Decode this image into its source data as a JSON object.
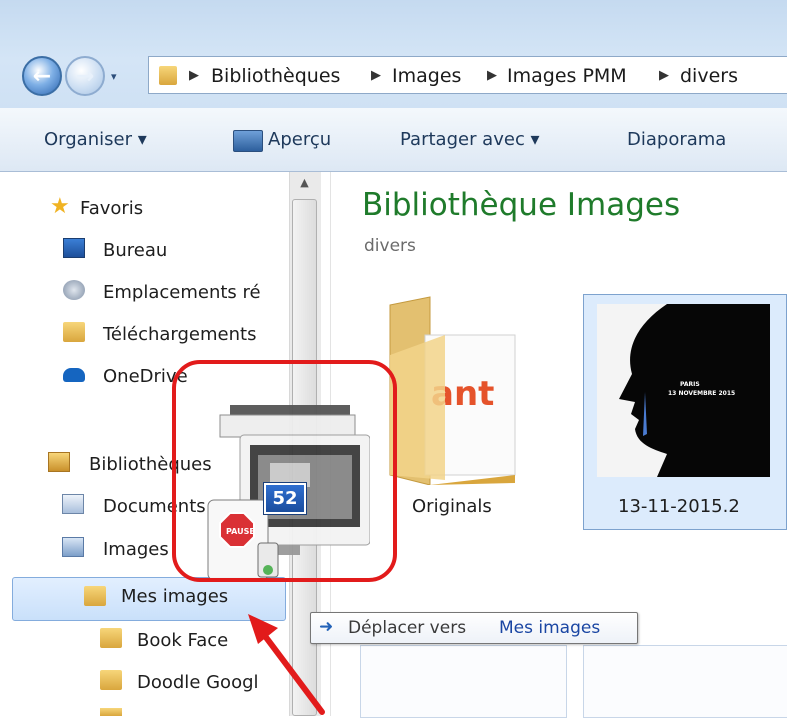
{
  "address_bar": {
    "history_arrow": "▾",
    "breadcrumb": [
      "Bibliothèques",
      "Images",
      "Images PMM",
      "divers"
    ]
  },
  "toolbar": {
    "organize_label": "Organiser ▾",
    "preview_label": "Aperçu",
    "share_label": "Partager avec ▾",
    "slideshow_label": "Diaporama"
  },
  "nav": {
    "favorites": "Favoris",
    "desktop": "Bureau",
    "recent_places": "Emplacements ré",
    "downloads": "Téléchargements",
    "onedrive": "OneDrive",
    "libraries": "Bibliothèques",
    "documents": "Documents",
    "images": "Images",
    "my_images": "Mes images",
    "book_face": "Book Face",
    "doodle": "Doodle Googl"
  },
  "content": {
    "title": "Bibliothèque Images",
    "subtitle": "divers",
    "items": [
      {
        "label": "Originals",
        "type": "folder"
      },
      {
        "label": "13-11-2015.2",
        "type": "image"
      }
    ],
    "thumb_text_1": "PARIS",
    "thumb_text_2": "13 NOVEMBRE 2015"
  },
  "drag": {
    "count_badge": "52",
    "pause_sign": "PAUSE",
    "ghost_text": "ant"
  },
  "tooltip": {
    "action": "Déplacer vers",
    "target": "Mes images"
  },
  "colors": {
    "annotation": "#e21b1b",
    "title_green": "#1f7b2b",
    "selection": "#c9e0fa"
  }
}
